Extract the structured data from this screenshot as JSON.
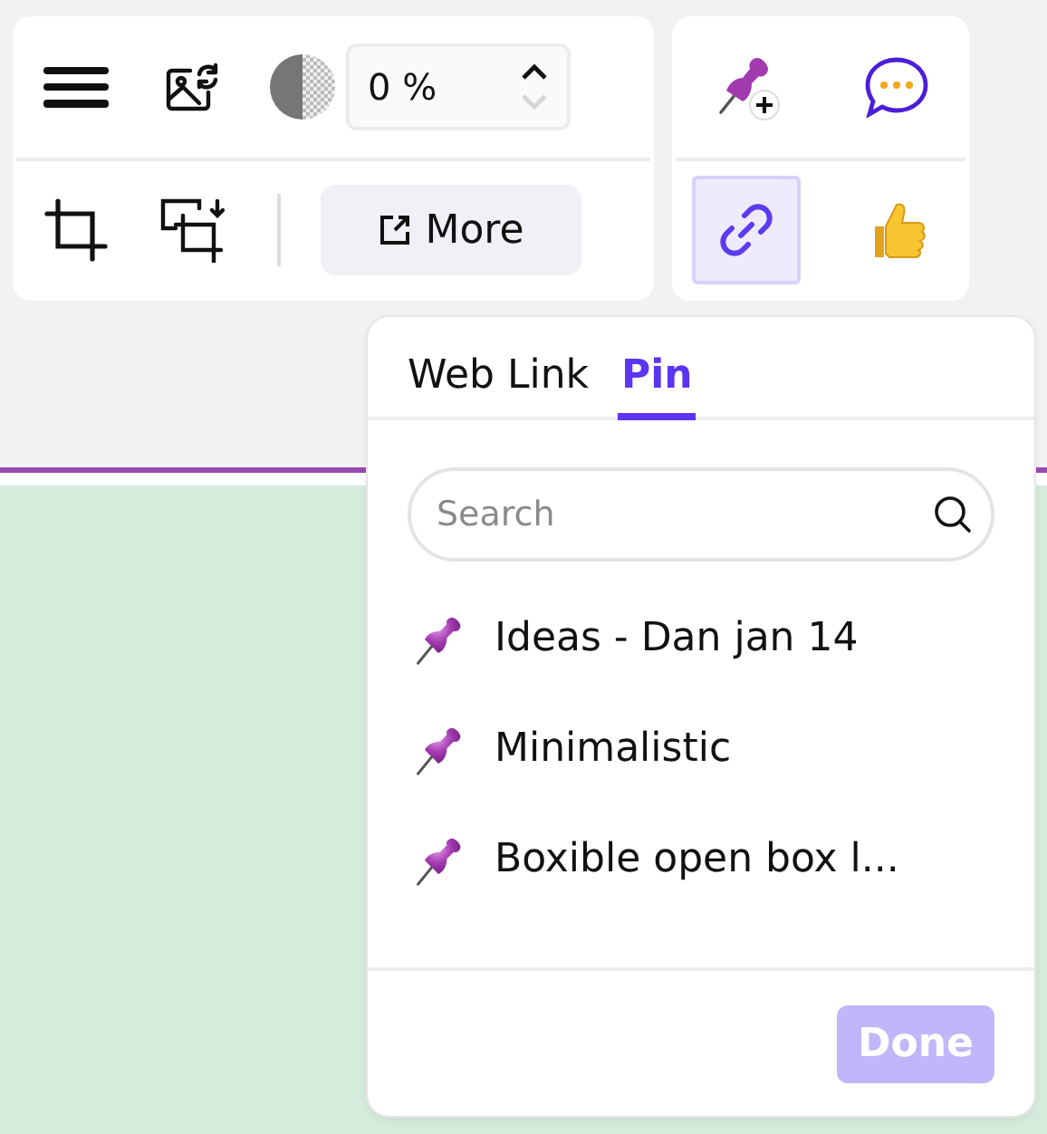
{
  "edit_toolbar": {
    "opacity_value": "0 %",
    "opacity_down_disabled": true,
    "more_button": "More"
  },
  "reaction_toolbar": {
    "link_selected": true
  },
  "popup": {
    "tabs": [
      {
        "label": "Web Link",
        "selected": false
      },
      {
        "label": "Pin",
        "selected": true
      }
    ],
    "search": {
      "placeholder": "Search"
    },
    "pins": [
      {
        "label": "Ideas - Dan jan 14"
      },
      {
        "label": "Minimalistic"
      },
      {
        "label": "Boxible open box l..."
      }
    ],
    "done_button": {
      "label": "Done",
      "disabled": true
    }
  }
}
